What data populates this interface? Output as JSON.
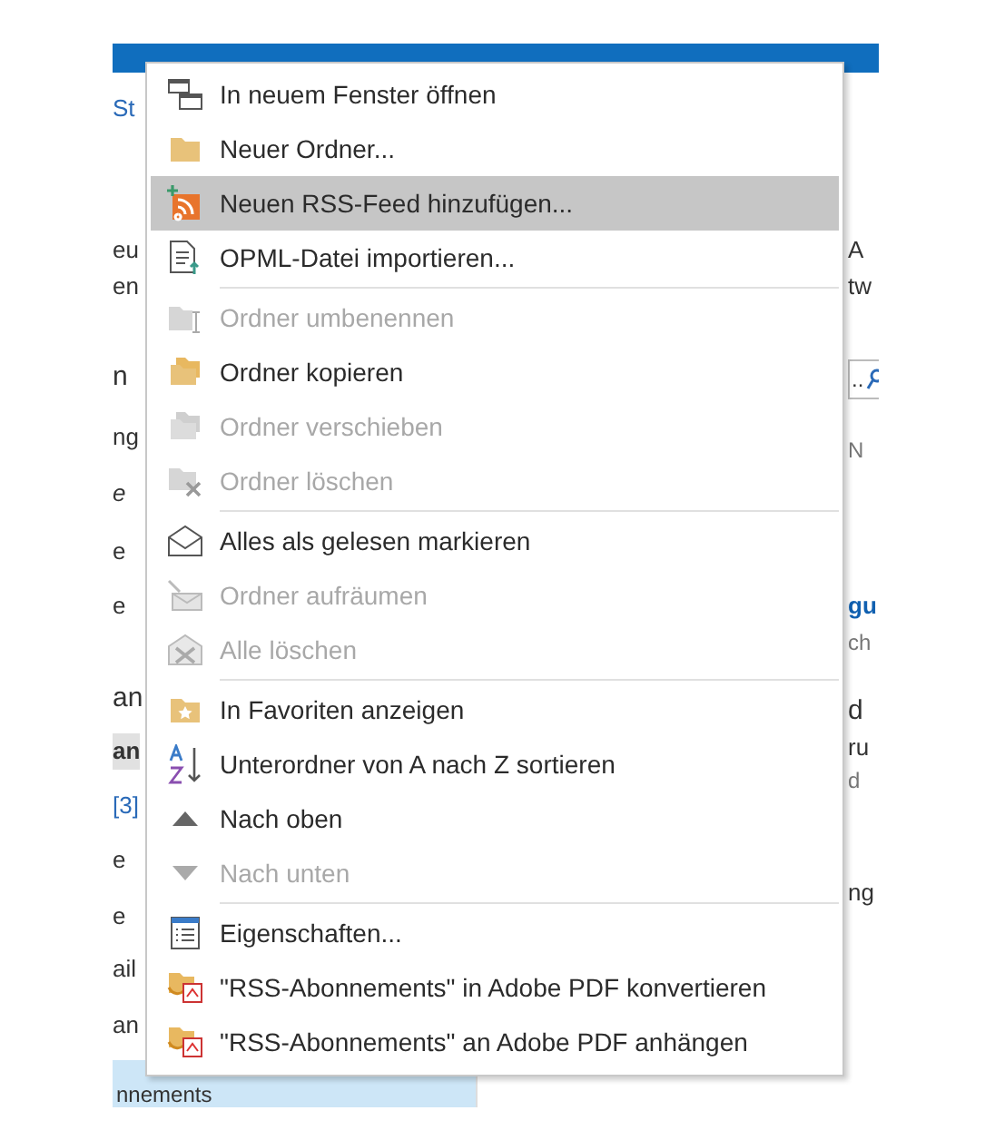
{
  "background_window": {
    "left_fragments": [
      {
        "text": "St",
        "kind": "link"
      },
      {
        "text": "eu",
        "kind": "plain"
      },
      {
        "text": "en",
        "kind": "plain"
      },
      {
        "text": "n",
        "kind": "heading"
      },
      {
        "text": "ng",
        "kind": "plain"
      },
      {
        "text": "e",
        "kind": "italic"
      },
      {
        "text": "e",
        "kind": "plain"
      },
      {
        "text": "e",
        "kind": "plain"
      },
      {
        "text": "an",
        "kind": "heading"
      },
      {
        "text": "an",
        "kind": "bold"
      },
      {
        "text": "[3]",
        "kind": "link"
      },
      {
        "text": "e",
        "kind": "plain"
      },
      {
        "text": "e",
        "kind": "plain"
      },
      {
        "text": "ail",
        "kind": "plain"
      },
      {
        "text": "an",
        "kind": "plain"
      }
    ],
    "selected_folder": {
      "text": "nnements"
    },
    "right_fragments": [
      {
        "text": "A",
        "kind": "plain"
      },
      {
        "text": "tw",
        "kind": "plain"
      },
      {
        "text": "..",
        "kind": "search"
      },
      {
        "text": "N",
        "kind": "dim"
      },
      {
        "text": "gu",
        "kind": "bold"
      },
      {
        "text": "ch",
        "kind": "dim"
      },
      {
        "text": "d",
        "kind": "heading"
      },
      {
        "text": "ru",
        "kind": "plain"
      },
      {
        "text": "d",
        "kind": "dim"
      },
      {
        "text": "ng",
        "kind": "plain"
      }
    ]
  },
  "context_menu": {
    "groups": [
      [
        {
          "label": "In neuem Fenster öffnen",
          "disabled": false,
          "selected": false
        },
        {
          "label": "Neuer Ordner...",
          "disabled": false,
          "selected": false
        },
        {
          "label": "Neuen RSS-Feed hinzufügen...",
          "disabled": false,
          "selected": true
        },
        {
          "label": "OPML-Datei importieren...",
          "disabled": false,
          "selected": false
        }
      ],
      [
        {
          "label": "Ordner umbenennen",
          "disabled": true,
          "selected": false
        },
        {
          "label": "Ordner kopieren",
          "disabled": false,
          "selected": false
        },
        {
          "label": "Ordner verschieben",
          "disabled": true,
          "selected": false
        },
        {
          "label": "Ordner löschen",
          "disabled": true,
          "selected": false
        }
      ],
      [
        {
          "label": "Alles als gelesen markieren",
          "disabled": false,
          "selected": false
        },
        {
          "label": "Ordner aufräumen",
          "disabled": true,
          "selected": false
        },
        {
          "label": "Alle löschen",
          "disabled": true,
          "selected": false
        }
      ],
      [
        {
          "label": "In Favoriten anzeigen",
          "disabled": false,
          "selected": false
        },
        {
          "label": "Unterordner von A nach Z sortieren",
          "disabled": false,
          "selected": false
        },
        {
          "label": "Nach oben",
          "disabled": false,
          "selected": false
        },
        {
          "label": "Nach unten",
          "disabled": true,
          "selected": false
        }
      ],
      [
        {
          "label": "Eigenschaften...",
          "disabled": false,
          "selected": false
        },
        {
          "label": "\"RSS-Abonnements\" in Adobe PDF konvertieren",
          "disabled": false,
          "selected": false
        },
        {
          "label": "\"RSS-Abonnements\" an Adobe PDF anhängen",
          "disabled": false,
          "selected": false
        }
      ]
    ]
  }
}
